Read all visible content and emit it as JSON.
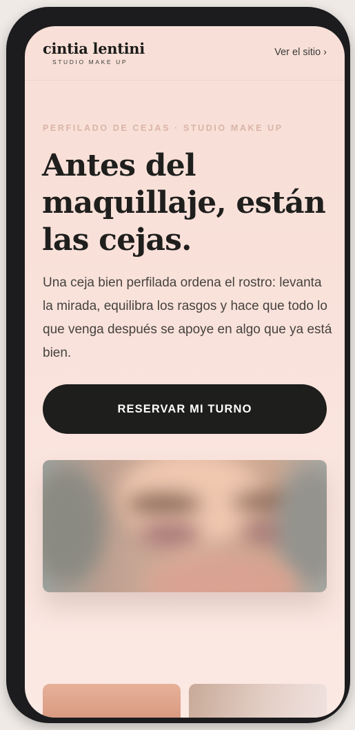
{
  "header": {
    "brand_name": "cintia lentini",
    "brand_tagline": "STUDIO MAKE UP",
    "site_link": "Ver el sitio ›"
  },
  "hero": {
    "eyebrow": "PERFILADO DE CEJAS · STUDIO MAKE UP",
    "headline": "Antes del maquillaje, están las cejas.",
    "lead": "Una ceja bien perfilada ordena el rostro: levanta la mirada, equilibra los rasgos y hace que todo lo que venga después se apoye en algo que ya está bien.",
    "cta_label": "RESERVAR MI TURNO"
  },
  "colors": {
    "background": "#f9e2db",
    "accent": "#1e1e1c",
    "eyebrow": "#d9b3a8"
  }
}
